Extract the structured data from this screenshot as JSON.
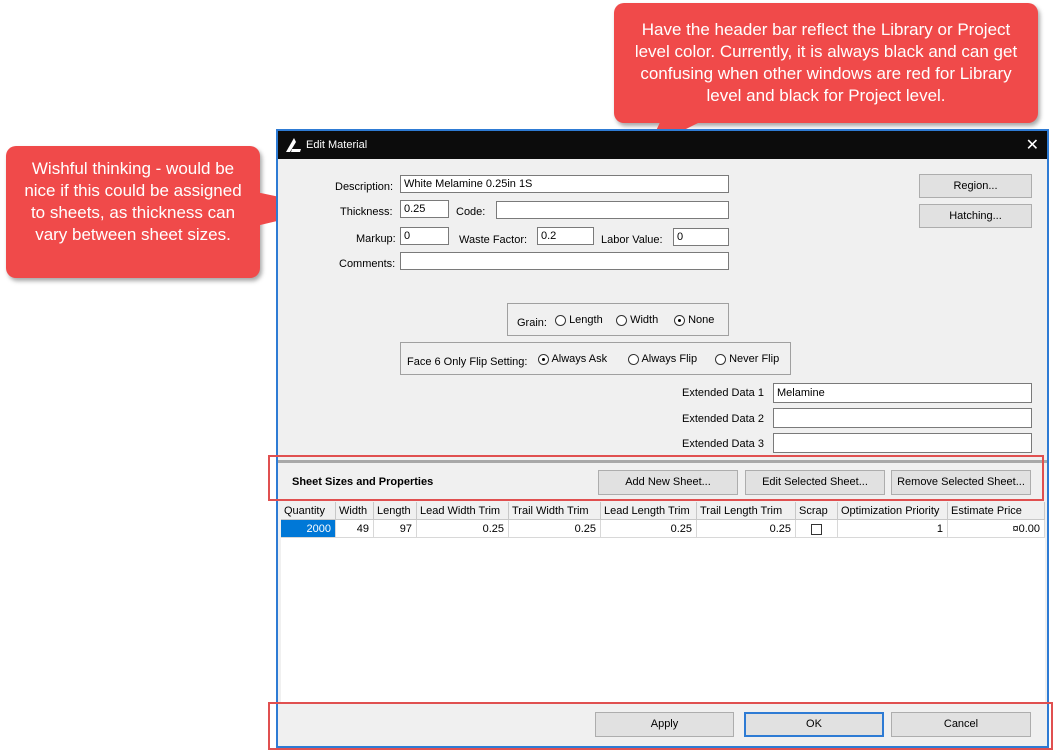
{
  "callouts": {
    "top": "Have the header bar reflect the Library or Project level color. Currently, it is always black and can get confusing when other windows are red for Library level and black for Project level.",
    "left": "Wishful thinking -  would be nice if this could be assigned to sheets, as thickness can vary between sheet sizes."
  },
  "window": {
    "title": "Edit Material",
    "close_glyph": "✕"
  },
  "form": {
    "description_label": "Description:",
    "description_value": "White Melamine 0.25in 1S",
    "thickness_label": "Thickness:",
    "thickness_value": "0.25",
    "code_label": "Code:",
    "code_value": "",
    "markup_label": "Markup:",
    "markup_value": "0",
    "waste_label": "Waste Factor:",
    "waste_value": "0.2",
    "labor_label": "Labor Value:",
    "labor_value": "0",
    "comments_label": "Comments:",
    "comments_value": "",
    "region_button": "Region...",
    "hatching_button": "Hatching..."
  },
  "grain": {
    "label": "Grain:",
    "options": [
      "Length",
      "Width",
      "None"
    ],
    "selected": "None"
  },
  "flip": {
    "label": "Face 6 Only Flip Setting:",
    "options": [
      "Always Ask",
      "Always Flip",
      "Never Flip"
    ],
    "selected": "Always Ask"
  },
  "extended": {
    "label1": "Extended Data 1",
    "value1": "Melamine",
    "label2": "Extended Data 2",
    "value2": "",
    "label3": "Extended Data 3",
    "value3": ""
  },
  "sheets": {
    "heading": "Sheet Sizes and Properties",
    "add_button": "Add New Sheet...",
    "edit_button": "Edit Selected Sheet...",
    "remove_button": "Remove Selected Sheet...",
    "columns": [
      "Quantity",
      "Width",
      "Length",
      "Lead Width Trim",
      "Trail Width Trim",
      "Lead Length Trim",
      "Trail Length Trim",
      "Scrap",
      "Optimization Priority",
      "Estimate Price"
    ],
    "rows": [
      [
        "2000",
        "49",
        "97",
        "0.25",
        "0.25",
        "0.25",
        "0.25",
        "",
        "1",
        "¤0.00"
      ]
    ]
  },
  "footer": {
    "apply": "Apply",
    "ok": "OK",
    "cancel": "Cancel"
  },
  "colors": {
    "callout": "#f04a4a",
    "titlebar": "#0c0c0c",
    "window_border": "#2e7bd4",
    "highlight_box": "#e05050",
    "selection": "#0078d7"
  }
}
